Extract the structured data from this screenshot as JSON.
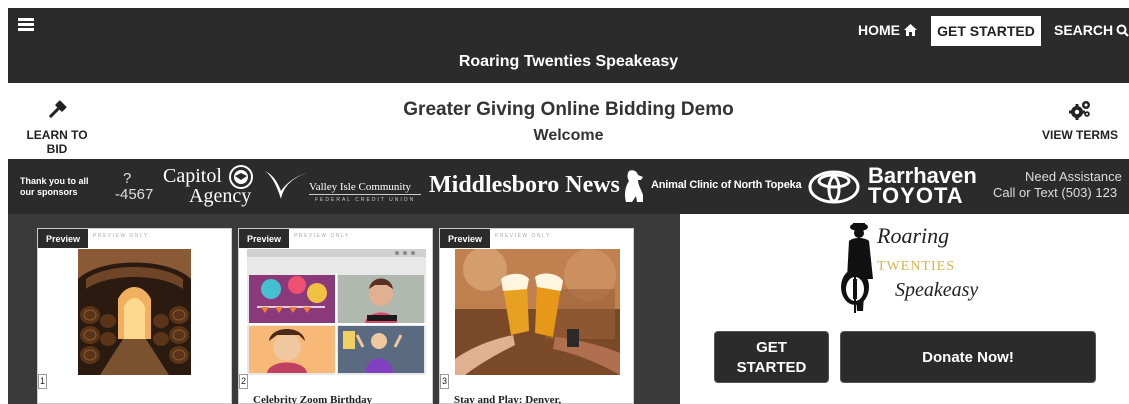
{
  "topbar": {
    "nav": {
      "home_label": "HOME",
      "get_started_label": "GET STARTED",
      "search_label": "SEARCH"
    },
    "event_title": "Roaring Twenties Speakeasy"
  },
  "subheader": {
    "learn_label": "LEARN TO BID",
    "demo_title": "Greater Giving Online Bidding Demo",
    "welcome": "Welcome",
    "terms_label": "VIEW TERMS"
  },
  "sponsors": {
    "thanks_text": "Thank you to all our sponsors",
    "fragment_line1": "?",
    "fragment_line2": "-4567",
    "capitol_line1": "Capitol",
    "capitol_line2": "Agency",
    "valley_name": "Valley Isle Community",
    "valley_sub": "FEDERAL CREDIT UNION",
    "middlesboro": "Middlesboro News",
    "animal_clinic": "Animal Clinic of North Topeka",
    "barrhaven_line1": "Barrhaven",
    "barrhaven_line2": "TOYOTA",
    "assist_line1": "Need Assistance",
    "assist_line2": "Call or Text (503) 123"
  },
  "items": [
    {
      "preview_label": "Preview",
      "preview_only": "PREVIEW ONLY",
      "number": "1",
      "title": ""
    },
    {
      "preview_label": "Preview",
      "preview_only": "PREVIEW ONLY",
      "number": "2",
      "title": "Celebrity Zoom Birthday"
    },
    {
      "preview_label": "Preview",
      "preview_only": "PREVIEW ONLY",
      "number": "3",
      "title": "Stay and Play: Denver,"
    }
  ],
  "event_logo": {
    "line1": "Roaring",
    "line2": "TWENTIES",
    "line3": "Speakeasy"
  },
  "actions": {
    "get_started_line1": "GET",
    "get_started_line2": "STARTED",
    "donate_label": "Donate Now!"
  },
  "colors": {
    "dark_bar": "#2b2b2b",
    "panel": "#3a3a3a",
    "gold": "#d8b44a"
  }
}
